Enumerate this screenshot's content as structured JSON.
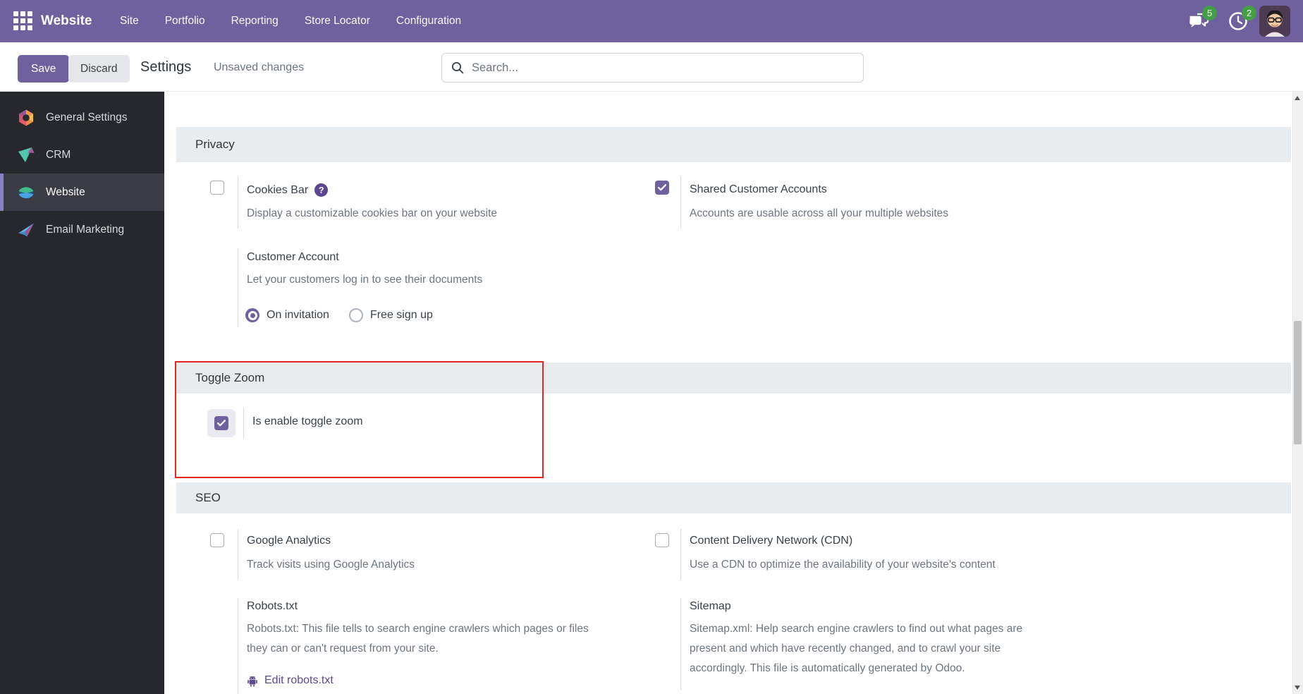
{
  "navbar": {
    "app_name": "Website",
    "menu": [
      "Site",
      "Portfolio",
      "Reporting",
      "Store Locator",
      "Configuration"
    ],
    "messages_badge": "5",
    "activities_badge": "2"
  },
  "control_panel": {
    "save_label": "Save",
    "discard_label": "Discard",
    "title": "Settings",
    "status": "Unsaved changes",
    "search_placeholder": "Search..."
  },
  "sidebar": {
    "items": [
      {
        "label": "General Settings",
        "icon": "general-settings-app-icon",
        "active": false
      },
      {
        "label": "CRM",
        "icon": "crm-app-icon",
        "active": false
      },
      {
        "label": "Website",
        "icon": "website-app-icon",
        "active": true
      },
      {
        "label": "Email Marketing",
        "icon": "email-marketing-app-icon",
        "active": false
      }
    ]
  },
  "privacy": {
    "title": "Privacy",
    "cookies_bar": {
      "label": "Cookies Bar",
      "description": "Display a customizable cookies bar on your website",
      "checked": false
    },
    "shared_customer_accounts": {
      "label": "Shared Customer Accounts",
      "description": "Accounts are usable across all your multiple websites",
      "checked": true
    },
    "customer_account": {
      "label": "Customer Account",
      "description": "Let your customers log in to see their documents",
      "options": [
        "On invitation",
        "Free sign up"
      ],
      "selected": "On invitation"
    }
  },
  "toggle_zoom": {
    "title": "Toggle Zoom",
    "is_enable_toggle_zoom": {
      "label": "Is enable toggle zoom",
      "checked": true
    }
  },
  "seo": {
    "title": "SEO",
    "google_analytics": {
      "label": "Google Analytics",
      "description": "Track visits using Google Analytics",
      "checked": false
    },
    "cdn": {
      "label": "Content Delivery Network (CDN)",
      "description": "Use a CDN to optimize the availability of your website's content",
      "checked": false
    },
    "robots": {
      "label": "Robots.txt",
      "description": "Robots.txt: This file tells to search engine crawlers which pages or files they can or can't request from your site.",
      "link_label": "Edit robots.txt"
    },
    "sitemap": {
      "label": "Sitemap",
      "description": "Sitemap.xml: Help search engine crawlers to find out what pages are present and which have recently changed, and to crawl your site accordingly. This file is automatically generated by Odoo."
    }
  },
  "colors": {
    "accent_purple": "#6e619e",
    "badge_green": "#43a047",
    "section_header_bg": "#e9ecef",
    "highlight_red": "#e8251f",
    "sidebar_bg": "#27282e"
  }
}
